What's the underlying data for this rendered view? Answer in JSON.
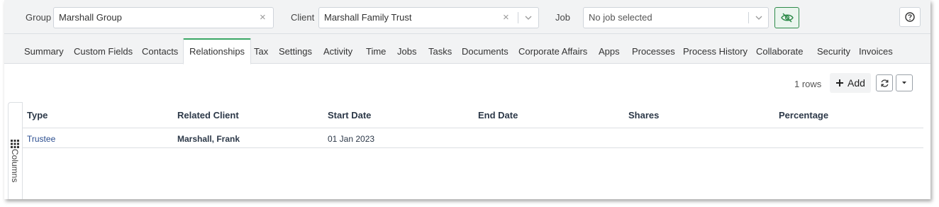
{
  "filters": {
    "group_label": "Group",
    "group_value": "Marshall Group",
    "client_label": "Client",
    "client_value": "Marshall Family Trust",
    "job_label": "Job",
    "job_placeholder": "No job selected",
    "clear_glyph": "×",
    "hide_icon": "eye-off-icon",
    "help_icon": "help-icon"
  },
  "tabs": [
    {
      "label": "Summary",
      "active": false
    },
    {
      "label": "Custom Fields",
      "active": false
    },
    {
      "label": "Contacts",
      "active": false
    },
    {
      "label": "Relationships",
      "active": true
    },
    {
      "label": "Tax",
      "active": false
    },
    {
      "label": "Settings",
      "active": false
    },
    {
      "label": "Activity",
      "active": false
    },
    {
      "label": "Time",
      "active": false
    },
    {
      "label": "Jobs",
      "active": false
    },
    {
      "label": "Tasks",
      "active": false
    },
    {
      "label": "Documents",
      "active": false
    },
    {
      "label": "Corporate Affairs",
      "active": false
    },
    {
      "label": "Apps",
      "active": false
    },
    {
      "label": "Processes",
      "active": false
    },
    {
      "label": "Process History",
      "active": false
    },
    {
      "label": "Collaborate",
      "active": false
    },
    {
      "label": "Security",
      "active": false
    },
    {
      "label": "Invoices",
      "active": false
    }
  ],
  "toolbar": {
    "row_count": "1 rows",
    "add_label": "Add",
    "refresh_icon": "refresh-icon",
    "dropdown_icon": "caret-down-icon"
  },
  "grid": {
    "columns_label": "Columns",
    "headers": [
      "Type",
      "Related Client",
      "Start Date",
      "End Date",
      "Shares",
      "Percentage"
    ],
    "rows": [
      {
        "type": "Trustee",
        "related_client": "Marshall, Frank",
        "start_date": "01 Jan 2023",
        "end_date": "",
        "shares": "",
        "percentage": ""
      }
    ]
  },
  "colors": {
    "accent_green": "#3aa765",
    "header_text": "#2c3848",
    "link_text": "#2a4d8f"
  }
}
